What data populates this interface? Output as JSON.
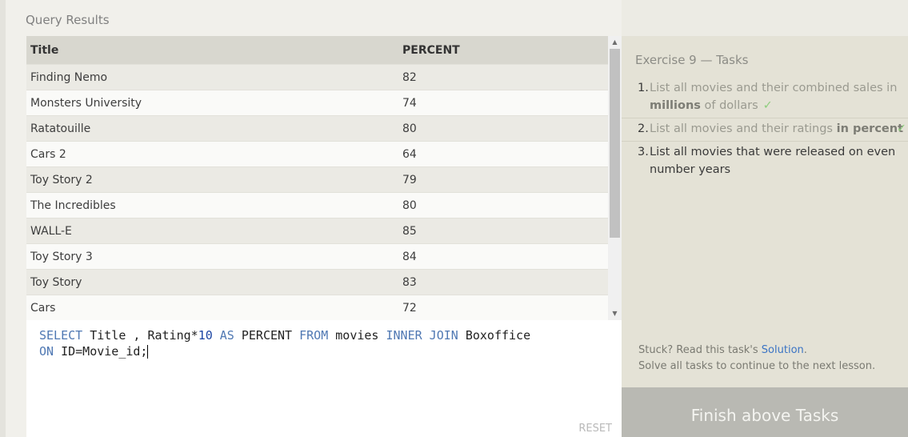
{
  "results": {
    "title": "Query Results",
    "columns": [
      "Title",
      "PERCENT"
    ],
    "rows": [
      [
        "Finding Nemo",
        "82"
      ],
      [
        "Monsters University",
        "74"
      ],
      [
        "Ratatouille",
        "80"
      ],
      [
        "Cars 2",
        "64"
      ],
      [
        "Toy Story 2",
        "79"
      ],
      [
        "The Incredibles",
        "80"
      ],
      [
        "WALL-E",
        "85"
      ],
      [
        "Toy Story 3",
        "84"
      ],
      [
        "Toy Story",
        "83"
      ],
      [
        "Cars",
        "72"
      ]
    ],
    "scroll_up_glyph": "▲",
    "scroll_down_glyph": "▼"
  },
  "editor": {
    "line1": {
      "t1": "SELECT",
      "t2": " Title , Rating*",
      "t3": "10",
      "t4": " ",
      "t5": "AS",
      "t6": " PERCENT ",
      "t7": "FROM",
      "t8": " movies ",
      "t9": "INNER JOIN",
      "t10": " Boxoffice"
    },
    "line2": {
      "t1": "ON",
      "t2": " ID=Movie_id;"
    },
    "reset_label": "RESET"
  },
  "exercise": {
    "title": "Exercise 9 — Tasks",
    "tasks": [
      {
        "num": "1.",
        "pre": "List all movies and their combined sales in ",
        "emph": "millions",
        "post": " of dollars",
        "check": "✓"
      },
      {
        "num": "2.",
        "pre": "List all movies and their ratings ",
        "emph": "in percent",
        "check": "✓"
      },
      {
        "num": "3.",
        "text": "List all movies that were released on even number years"
      }
    ],
    "stuck_prefix": "Stuck? Read this task's ",
    "solution_link": "Solution",
    "stuck_suffix": ".",
    "solve_all": "Solve all tasks to continue to the next lesson.",
    "finish_label": "Finish above Tasks"
  },
  "colors": {
    "keyword": "#4f78b3",
    "number": "#1c45a3",
    "check": "#8fce7e",
    "link": "#3b74c4",
    "finish_bg": "#b9b9b3"
  }
}
